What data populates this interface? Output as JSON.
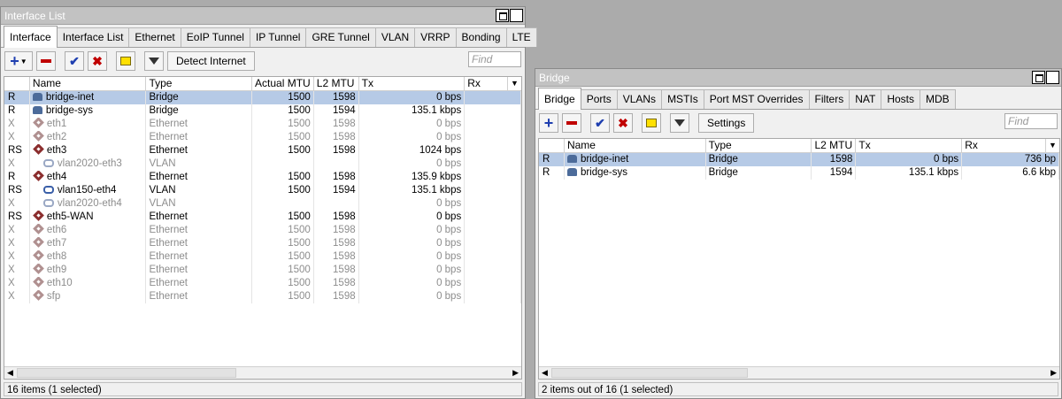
{
  "interface_window": {
    "title": "Interface List",
    "tabs": [
      "Interface",
      "Interface List",
      "Ethernet",
      "EoIP Tunnel",
      "IP Tunnel",
      "GRE Tunnel",
      "VLAN",
      "VRRP",
      "Bonding",
      "LTE"
    ],
    "toolbar": {
      "detect_label": "Detect Internet",
      "find_placeholder": "Find"
    },
    "columns": [
      "",
      "Name",
      "Type",
      "Actual MTU",
      "L2 MTU",
      "Tx",
      "Rx"
    ],
    "rows": [
      {
        "flag": "R",
        "name": "bridge-inet",
        "type": "Bridge",
        "mtu": "1500",
        "l2mtu": "1598",
        "tx": "0 bps",
        "icon": "bridge-icon",
        "indent": false,
        "disabled": false,
        "selected": true
      },
      {
        "flag": "R",
        "name": "bridge-sys",
        "type": "Bridge",
        "mtu": "1500",
        "l2mtu": "1594",
        "tx": "135.1 kbps",
        "icon": "bridge-icon",
        "indent": false,
        "disabled": false,
        "selected": false
      },
      {
        "flag": "X",
        "name": "eth1",
        "type": "Ethernet",
        "mtu": "1500",
        "l2mtu": "1598",
        "tx": "0 bps",
        "icon": "ethernet-icon",
        "indent": false,
        "disabled": true,
        "selected": false
      },
      {
        "flag": "X",
        "name": "eth2",
        "type": "Ethernet",
        "mtu": "1500",
        "l2mtu": "1598",
        "tx": "0 bps",
        "icon": "ethernet-icon",
        "indent": false,
        "disabled": true,
        "selected": false
      },
      {
        "flag": "RS",
        "name": "eth3",
        "type": "Ethernet",
        "mtu": "1500",
        "l2mtu": "1598",
        "tx": "1024 bps",
        "icon": "ethernet-icon",
        "indent": false,
        "disabled": false,
        "selected": false
      },
      {
        "flag": "X",
        "name": "vlan2020-eth3",
        "type": "VLAN",
        "mtu": "",
        "l2mtu": "",
        "tx": "0 bps",
        "icon": "vlan-icon",
        "indent": true,
        "disabled": true,
        "selected": false
      },
      {
        "flag": "R",
        "name": "eth4",
        "type": "Ethernet",
        "mtu": "1500",
        "l2mtu": "1598",
        "tx": "135.9 kbps",
        "icon": "ethernet-icon",
        "indent": false,
        "disabled": false,
        "selected": false
      },
      {
        "flag": "RS",
        "name": "vlan150-eth4",
        "type": "VLAN",
        "mtu": "1500",
        "l2mtu": "1594",
        "tx": "135.1 kbps",
        "icon": "vlan-icon",
        "indent": true,
        "disabled": false,
        "selected": false
      },
      {
        "flag": "X",
        "name": "vlan2020-eth4",
        "type": "VLAN",
        "mtu": "",
        "l2mtu": "",
        "tx": "0 bps",
        "icon": "vlan-icon",
        "indent": true,
        "disabled": true,
        "selected": false
      },
      {
        "flag": "RS",
        "name": "eth5-WAN",
        "type": "Ethernet",
        "mtu": "1500",
        "l2mtu": "1598",
        "tx": "0 bps",
        "icon": "ethernet-icon",
        "indent": false,
        "disabled": false,
        "selected": false
      },
      {
        "flag": "X",
        "name": "eth6",
        "type": "Ethernet",
        "mtu": "1500",
        "l2mtu": "1598",
        "tx": "0 bps",
        "icon": "ethernet-icon",
        "indent": false,
        "disabled": true,
        "selected": false
      },
      {
        "flag": "X",
        "name": "eth7",
        "type": "Ethernet",
        "mtu": "1500",
        "l2mtu": "1598",
        "tx": "0 bps",
        "icon": "ethernet-icon",
        "indent": false,
        "disabled": true,
        "selected": false
      },
      {
        "flag": "X",
        "name": "eth8",
        "type": "Ethernet",
        "mtu": "1500",
        "l2mtu": "1598",
        "tx": "0 bps",
        "icon": "ethernet-icon",
        "indent": false,
        "disabled": true,
        "selected": false
      },
      {
        "flag": "X",
        "name": "eth9",
        "type": "Ethernet",
        "mtu": "1500",
        "l2mtu": "1598",
        "tx": "0 bps",
        "icon": "ethernet-icon",
        "indent": false,
        "disabled": true,
        "selected": false
      },
      {
        "flag": "X",
        "name": "eth10",
        "type": "Ethernet",
        "mtu": "1500",
        "l2mtu": "1598",
        "tx": "0 bps",
        "icon": "ethernet-icon",
        "indent": false,
        "disabled": true,
        "selected": false
      },
      {
        "flag": "X",
        "name": "sfp",
        "type": "Ethernet",
        "mtu": "1500",
        "l2mtu": "1598",
        "tx": "0 bps",
        "icon": "ethernet-icon",
        "indent": false,
        "disabled": true,
        "selected": false
      }
    ],
    "status": "16 items (1 selected)"
  },
  "bridge_window": {
    "title": "Bridge",
    "tabs": [
      "Bridge",
      "Ports",
      "VLANs",
      "MSTIs",
      "Port MST Overrides",
      "Filters",
      "NAT",
      "Hosts",
      "MDB"
    ],
    "toolbar": {
      "settings_label": "Settings",
      "find_placeholder": "Find"
    },
    "columns": [
      "",
      "Name",
      "Type",
      "L2 MTU",
      "Tx",
      "Rx"
    ],
    "rows": [
      {
        "flag": "R",
        "name": "bridge-inet",
        "type": "Bridge",
        "l2mtu": "1598",
        "tx": "0 bps",
        "rx": "736 bp",
        "selected": true
      },
      {
        "flag": "R",
        "name": "bridge-sys",
        "type": "Bridge",
        "l2mtu": "1594",
        "tx": "135.1 kbps",
        "rx": "6.6 kbp",
        "selected": false
      }
    ],
    "status": "2 items out of 16 (1 selected)"
  },
  "colors": {
    "selection": "#b6cae6",
    "titlebar": "#c2c2c2",
    "desktop": "#ababab"
  }
}
